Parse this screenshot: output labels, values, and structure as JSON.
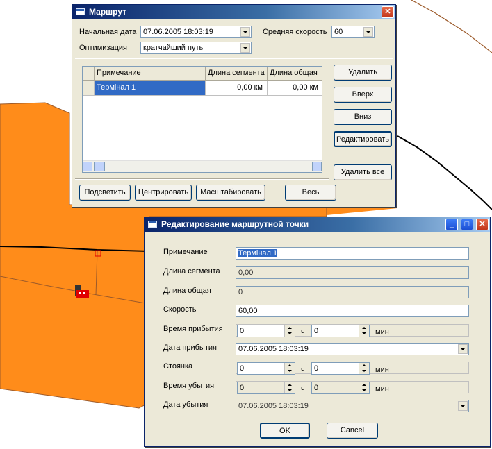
{
  "colors": {
    "map_fill": "#ff8c1a",
    "map_edge": "#9c5a2a",
    "title_start": "#0a246a",
    "selection": "#316ac5"
  },
  "route_window": {
    "title": "Маршрут",
    "start_date_label": "Начальная дата",
    "start_date_value": "07.06.2005 18:03:19",
    "avg_speed_label": "Средняя скорость",
    "avg_speed_value": "60",
    "optimization_label": "Оптимизация",
    "optimization_value": "кратчайший путь",
    "table": {
      "columns": [
        "Примечание",
        "Длина сегмента",
        "Длина общая"
      ],
      "rows": [
        {
          "note": "Термінал 1",
          "segment": "0,00 км",
          "total": "0,00 км"
        }
      ]
    },
    "buttons": {
      "delete": "Удалить",
      "up": "Вверх",
      "down": "Вниз",
      "edit": "Редактировать",
      "delete_all": "Удалить все"
    },
    "bottom_buttons": {
      "highlight": "Подсветить",
      "center": "Центрировать",
      "scale": "Масштабировать",
      "all": "Весь"
    },
    "close_icon": "close-icon"
  },
  "edit_window": {
    "title": "Редактирование маршрутной точки",
    "note_label": "Примечание",
    "note_value": "Термінал 1",
    "segment_label": "Длина сегмента",
    "segment_value": "0,00",
    "total_label": "Длина общая",
    "total_value": "0",
    "speed_label": "Скорость",
    "speed_value": "60,00",
    "arrival_time_label": "Время прибытия",
    "arrival_time_h": "0",
    "arrival_time_m": "0",
    "arrival_date_label": "Дата прибытия",
    "arrival_date_value": "07.06.2005 18:03:19",
    "stop_label": "Стоянка",
    "stop_h": "0",
    "stop_m": "0",
    "departure_time_label": "Время убытия",
    "departure_time_h": "0",
    "departure_time_m": "0",
    "departure_date_label": "Дата убытия",
    "departure_date_value": "07.06.2005 18:03:19",
    "hours_unit": "ч",
    "minutes_unit": "мин",
    "ok_label": "OK",
    "cancel_label": "Cancel"
  }
}
